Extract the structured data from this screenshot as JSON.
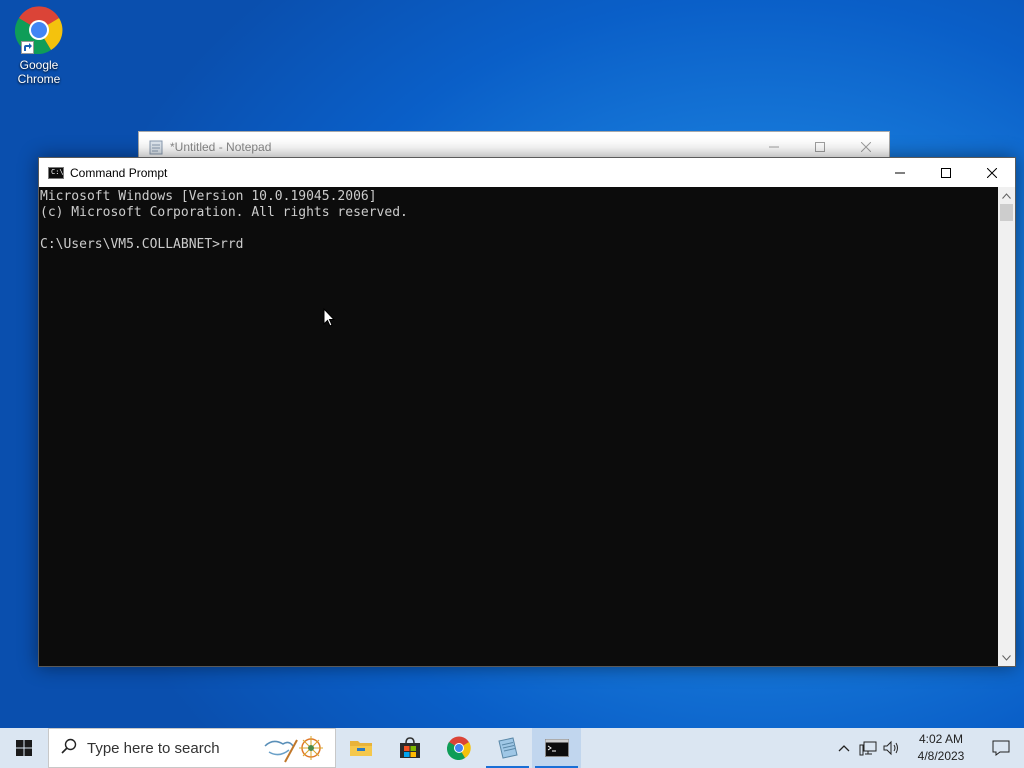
{
  "desktop": {
    "icons": [
      {
        "label": "Google Chrome",
        "icon": "chrome-icon"
      }
    ]
  },
  "notepad": {
    "title": "*Untitled - Notepad"
  },
  "cmd": {
    "title": "Command Prompt",
    "lines": [
      "Microsoft Windows [Version 10.0.19045.2006]",
      "(c) Microsoft Corporation. All rights reserved.",
      "",
      "C:\\Users\\VM5.COLLABNET>rrd"
    ]
  },
  "taskbar": {
    "search_placeholder": "Type here to search",
    "apps": [
      {
        "name": "file-explorer",
        "icon": "folder-icon"
      },
      {
        "name": "microsoft-store",
        "icon": "store-icon"
      },
      {
        "name": "google-chrome",
        "icon": "chrome-icon"
      },
      {
        "name": "notepad",
        "icon": "notepad-icon"
      },
      {
        "name": "command-prompt",
        "icon": "cmd-icon"
      }
    ],
    "clock": {
      "time": "4:02 AM",
      "date": "4/8/2023"
    }
  },
  "colors": {
    "console_bg": "#0c0c0c",
    "console_fg": "#cccccc",
    "taskbar_bg": "#dbe6f2",
    "accent": "#1a6fd6"
  }
}
